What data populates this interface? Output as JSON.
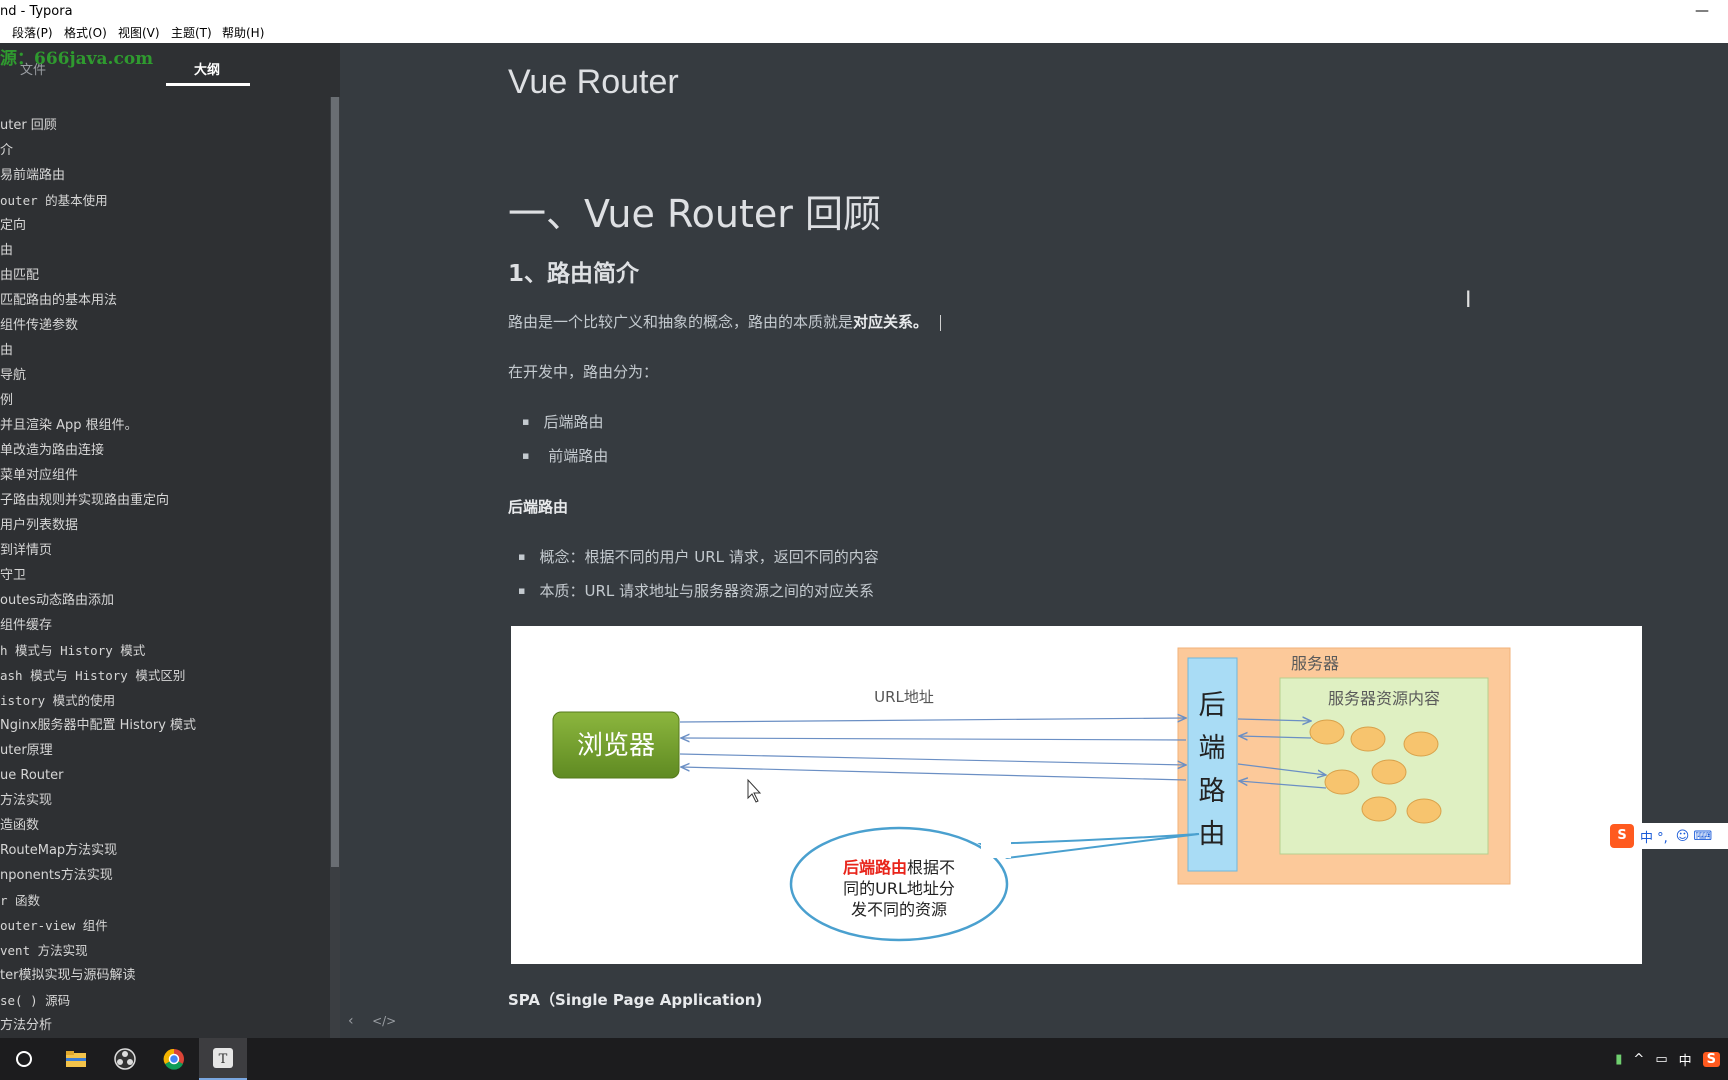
{
  "window": {
    "title": "nd - Typora",
    "minimize": "—"
  },
  "menu": [
    "段落(P)",
    "格式(O)",
    "视图(V)",
    "主题(T)",
    "帮助(H)"
  ],
  "sidebar": {
    "watermark": "源：666java.com",
    "tabs": [
      {
        "label": "文件",
        "active": false
      },
      {
        "label": "大纲",
        "active": true
      }
    ],
    "outline": [
      {
        "text": "uter 回顾"
      },
      {
        "text": "介"
      },
      {
        "text": "易前端路由"
      },
      {
        "text": "outer 的基本使用",
        "mono": true
      },
      {
        "text": "定向"
      },
      {
        "text": "由"
      },
      {
        "text": "由匹配"
      },
      {
        "text": "匹配路由的基本用法"
      },
      {
        "text": "组件传递参数"
      },
      {
        "text": "由"
      },
      {
        "text": "导航"
      },
      {
        "text": "例"
      },
      {
        "text": "并且渲染 App 根组件。"
      },
      {
        "text": "单改造为路由连接"
      },
      {
        "text": "菜单对应组件"
      },
      {
        "text": "子路由规则并实现路由重定向"
      },
      {
        "text": "用户列表数据"
      },
      {
        "text": "到详情页"
      },
      {
        "text": "守卫"
      },
      {
        "text": "outes动态路由添加"
      },
      {
        "text": "组件缓存"
      },
      {
        "text": "h 模式与 History 模式",
        "mono": true
      },
      {
        "text": "ash 模式与 History 模式区别",
        "mono": true
      },
      {
        "text": "istory 模式的使用",
        "mono": true
      },
      {
        "text": "Nginx服务器中配置 History 模式"
      },
      {
        "text": "uter原理"
      },
      {
        "text": "ue Router"
      },
      {
        "text": "方法实现"
      },
      {
        "text": "造函数"
      },
      {
        "text": "RouteMap方法实现"
      },
      {
        "text": "nponents方法实现"
      },
      {
        "text": "r 函数",
        "mono": true
      },
      {
        "text": "outer-view 组件",
        "mono": true
      },
      {
        "text": "vent 方法实现",
        "mono": true
      },
      {
        "text": "ter模拟实现与源码解读"
      },
      {
        "text": "se( ) 源码",
        "mono": true
      },
      {
        "text": "方法分析"
      }
    ],
    "footer_left": "‹",
    "footer_code": "</>"
  },
  "editor": {
    "doc_title": "Vue Router",
    "h1": "一、Vue Router 回顾",
    "h2": "1、路由简介",
    "para1_plain": "路由是一个比较广义和抽象的概念，路由的本质就是",
    "para1_bold": "对应关系。",
    "para2": "在开发中，路由分为：",
    "list1": [
      "后端路由",
      " 前端路由"
    ],
    "subhead": "后端路由",
    "list2": [
      "概念：根据不同的用户 URL 请求，返回不同的内容",
      "本质：URL 请求地址与服务器资源之间的对应关系"
    ],
    "spa": "SPA（Single  Page Application)"
  },
  "diagram": {
    "browser": "浏览器",
    "url_label": "URL地址",
    "server": "服务器",
    "router_chars": [
      "后",
      "端",
      "路",
      "由"
    ],
    "resources": "服务器资源内容",
    "callout_highlight": "后端路由",
    "callout_line1_rest": "根据不",
    "callout_line2": "同的URL地址分",
    "callout_line3": "发不同的资源",
    "colors": {
      "browser": "#6f9a2c",
      "router": "#a9dcf5",
      "server": "#fcc99a",
      "content": "#dff0c2",
      "dot": "#f7c46e",
      "highlight": "#e8241a",
      "arrow": "#6b8fc4"
    }
  },
  "ime": {
    "logo": "S",
    "text": "中 °,",
    "icons": "☺ ⌨"
  },
  "taskbar": {
    "tray": [
      "▮",
      "^",
      "▭",
      "中",
      "S"
    ]
  }
}
